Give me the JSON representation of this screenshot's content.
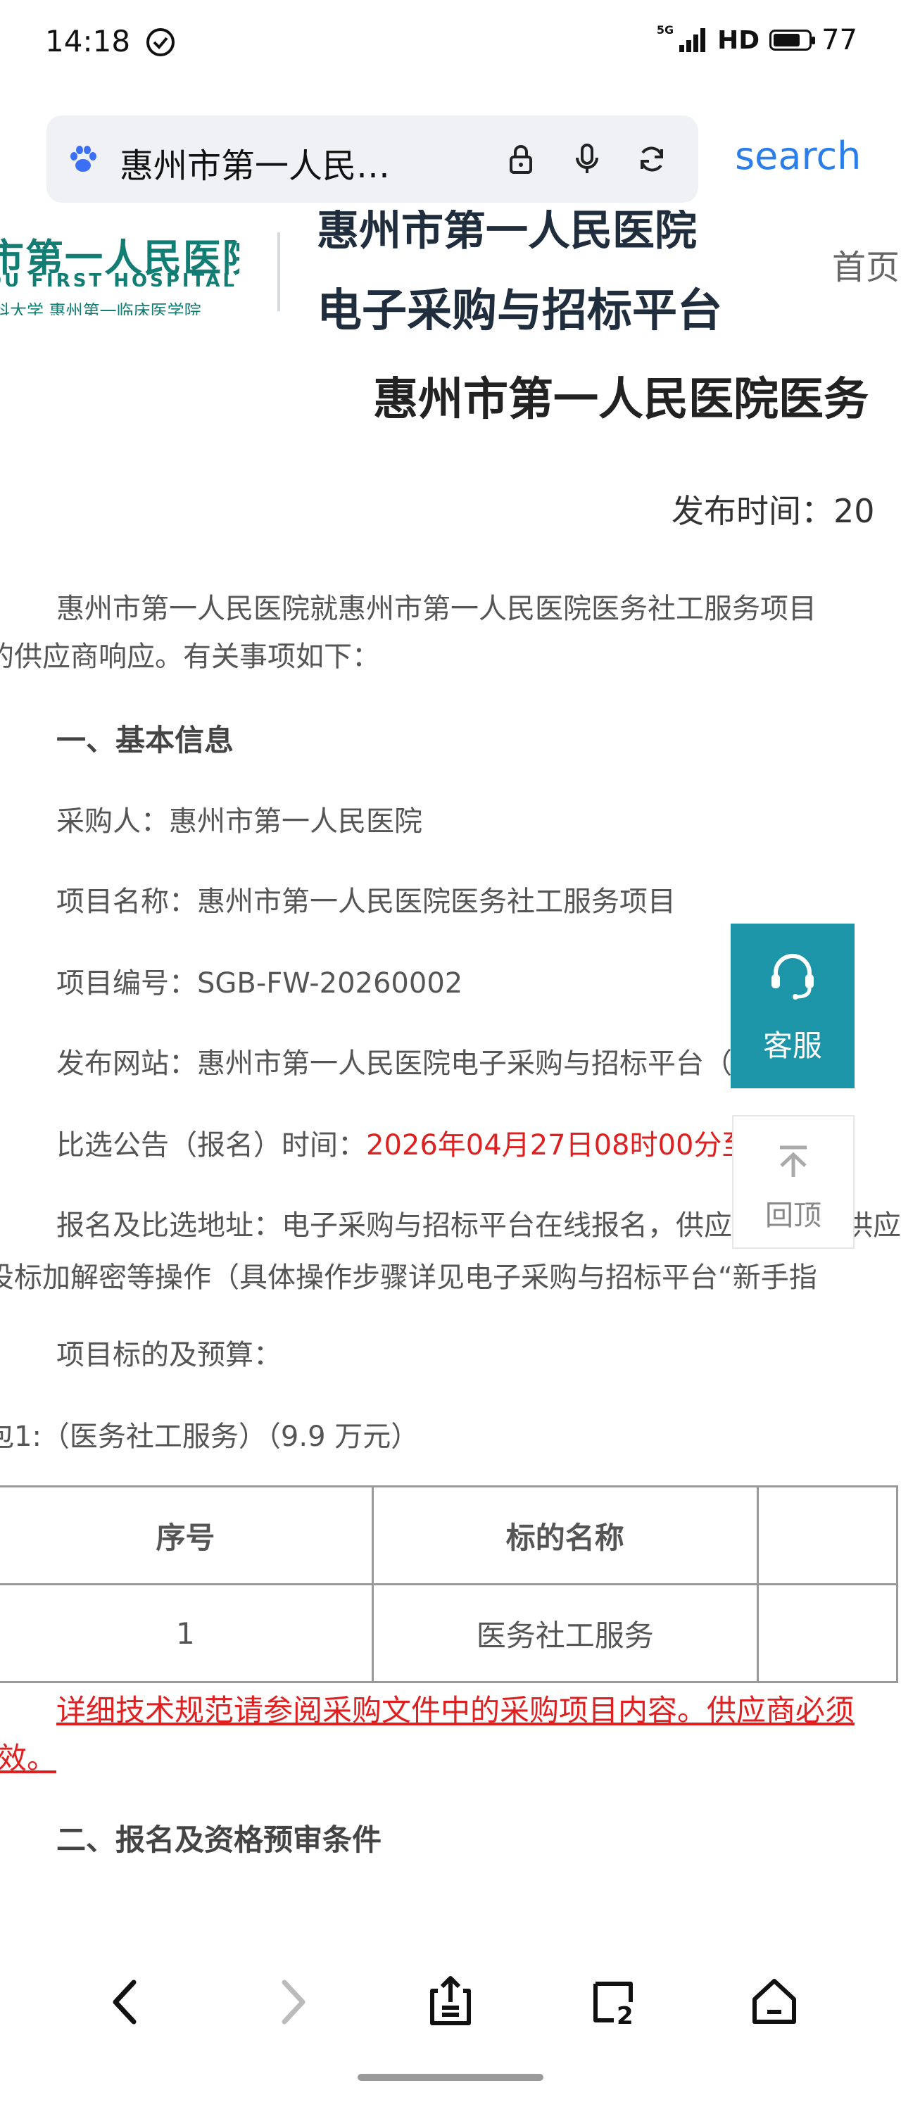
{
  "status_bar": {
    "time": "14:18",
    "network": "5G",
    "hd": "HD",
    "battery": "77",
    "battery_level": 0.77
  },
  "browser": {
    "url_text": "惠州市第一人民…",
    "search_label": "search"
  },
  "site": {
    "logo_cn": "市第一人民医院",
    "logo_en": "OU FIRST HOSPITAL",
    "logo_sub": "科大学 惠州第一临床医学院",
    "platform_line1": "惠州市第一人民医院",
    "platform_line2": "电子采购与招标平台",
    "nav_home": "首页"
  },
  "article": {
    "title": "惠州市第一人民医院医务",
    "publish_time": "发布时间：20",
    "intro_line1": "惠州市第一人民医院就惠州市第一人民医院医务社工服务项目",
    "intro_line2": "的供应商响应。有关事项如下：",
    "section1_heading": "一、基本信息",
    "purchaser": "采购人：惠州市第一人民医院",
    "project_name": "项目名称：惠州市第一人民医院医务社工服务项目",
    "project_number": "项目编号：SGB-FW-20260002",
    "website": "发布网站：惠州市第一人民医院电子采购与招标平台（https",
    "notice_time_label": "比选公告（报名）时间：",
    "notice_time_value": "2026年04月27日08时00分至2026",
    "address_line1": "报名及比选地址：电子采购与招标平台在线报名，供应商须在线供应",
    "address_line2": "投标加解密等操作（具体操作步骤详见电子采购与招标平台“新手指",
    "budget_heading": "项目标的及预算：",
    "package": "包1:（医务社工服务）（9.9 万元）",
    "table": {
      "headers": [
        "序号",
        "标的名称",
        ""
      ],
      "rows": [
        [
          "1",
          "医务社工服务",
          ""
        ]
      ]
    },
    "note_line1": "详细技术规范请参阅采购文件中的采购项目内容。供应商必须",
    "note_line2": "效。",
    "section2_heading": "二、报名及资格预审条件"
  },
  "widgets": {
    "kefu_label": "客服",
    "totop_label": "回顶"
  },
  "icons": {
    "status_check": "check-circle-icon",
    "address_bar": [
      "paw-icon",
      "lock-icon",
      "mic-icon",
      "refresh-icon"
    ],
    "bottom_nav": [
      "back-icon",
      "forward-icon",
      "share-icon",
      "tabs-icon",
      "home-icon"
    ]
  },
  "bottom_nav": {
    "tabs_count": "2"
  },
  "colors": {
    "accent_blue": "#2b7de9",
    "hospital_green": "#127d73",
    "kefu_teal": "#1b95a7",
    "alert_red": "#e02020"
  }
}
